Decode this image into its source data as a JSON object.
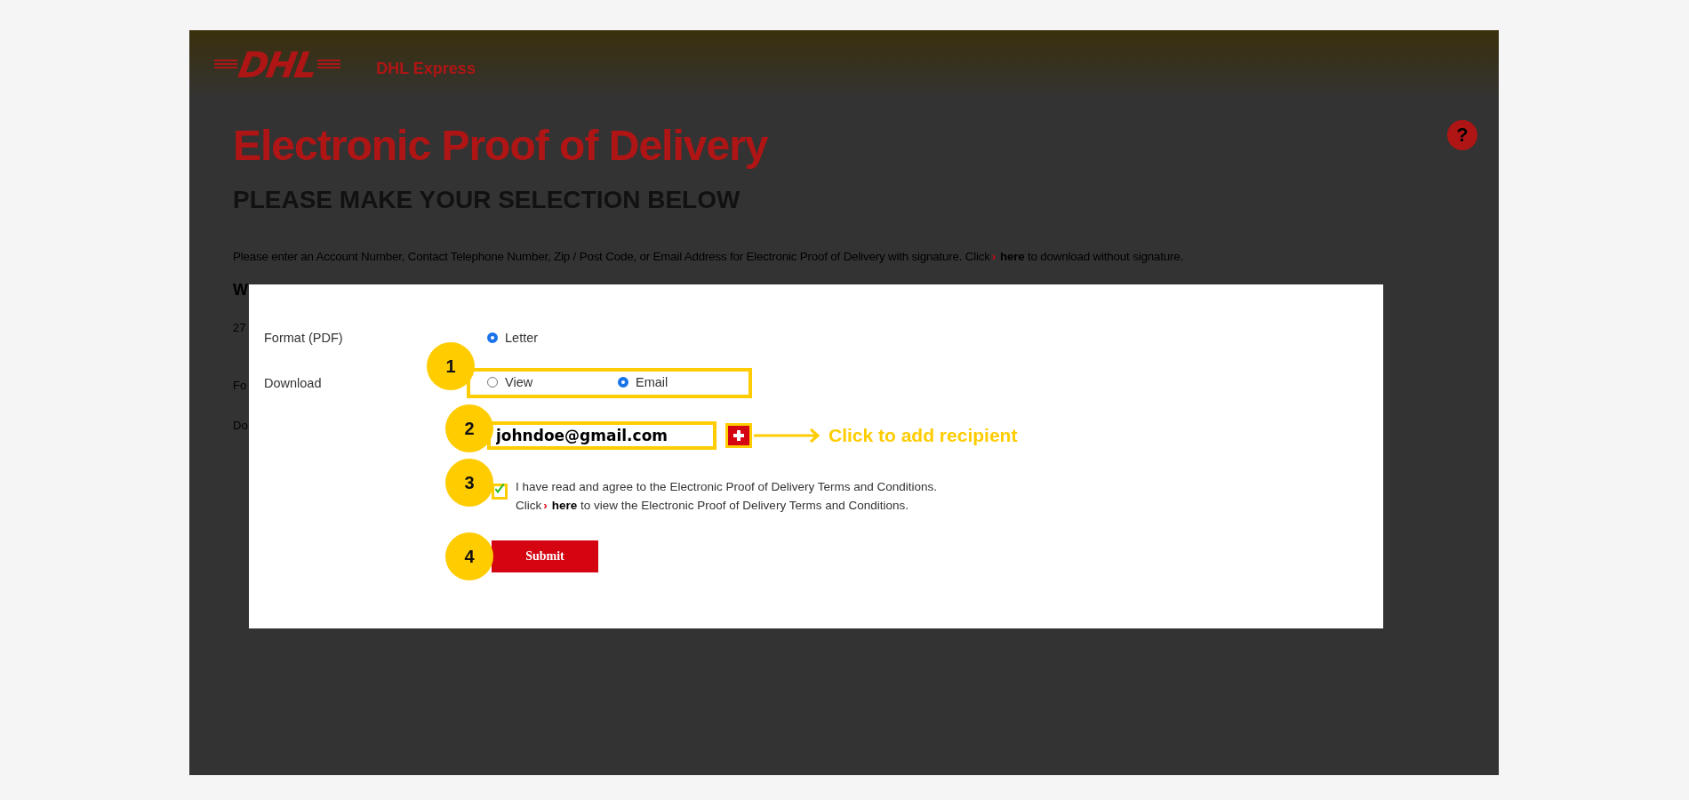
{
  "header": {
    "logo_text": "DHL",
    "brand": "DHL Express",
    "help": "?"
  },
  "page": {
    "title": "Electronic Proof of Delivery",
    "subtitle": "PLEASE MAKE YOUR SELECTION BELOW",
    "intro": "Please enter an Account Number, Contact Telephone Number, Zip / Post Code, or Email Address for Electronic Proof of Delivery with signature. Click",
    "intro_chevron": "›",
    "intro_link": "here",
    "intro_after": "to download without signature.",
    "fragments": [
      {
        "kind": "heading",
        "text": "W"
      },
      {
        "kind": "text",
        "text": "27"
      },
      {
        "kind": "text",
        "text": "Fo"
      },
      {
        "kind": "text",
        "text": "Do"
      }
    ]
  },
  "dialog": {
    "format": {
      "label": "Format (PDF)",
      "options": [
        {
          "label": "Letter",
          "selected": true
        }
      ]
    },
    "download": {
      "label": "Download",
      "options": [
        {
          "label": "View",
          "selected": false
        },
        {
          "label": "Email",
          "selected": true
        }
      ]
    },
    "email": {
      "value": "johndoe@gmail.com"
    },
    "terms": {
      "checked": true,
      "text": "I have read and agree to the Electronic Proof of Delivery Terms and Conditions.",
      "click": "Click",
      "chevron": "›",
      "link": "here",
      "after": "to view the Electronic Proof of Delivery Terms and Conditions."
    },
    "submit": "Submit"
  },
  "annotations": {
    "markers": [
      "1",
      "2",
      "3",
      "4"
    ],
    "callout": "Click to add recipient"
  }
}
